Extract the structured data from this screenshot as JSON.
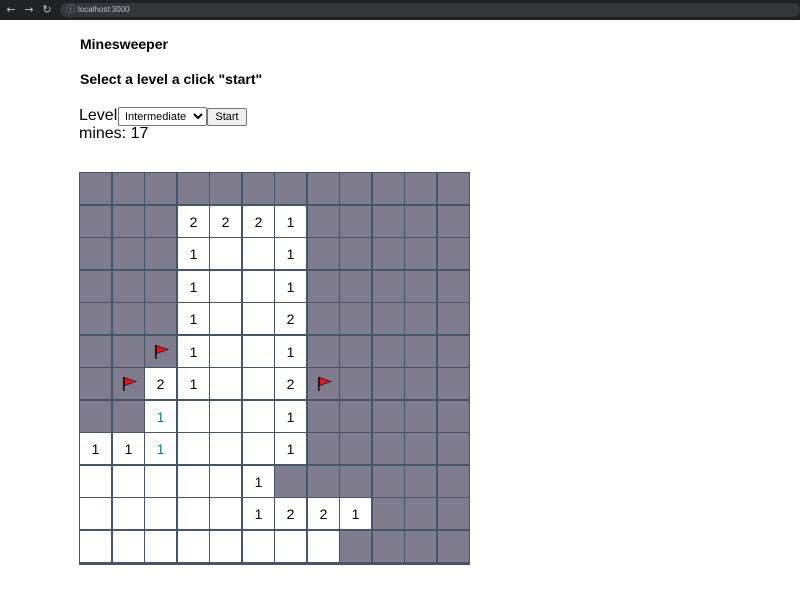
{
  "browser": {
    "url": "localhost:3000",
    "icons": [
      "back-arrow-icon",
      "forward-arrow-icon",
      "reload-icon",
      "info-icon"
    ]
  },
  "page": {
    "title": "Minesweeper",
    "subtitle": "Select a level a click \"start\"",
    "level_label": "Level:",
    "level_selected": "Intermediate",
    "start_label": "Start",
    "mines_text": "mines: 17"
  },
  "colors": {
    "hidden_cell": "#7f7c8e",
    "open_cell": "#ffffff",
    "grid_line": "#475569",
    "flag": "#d11a2a",
    "number_teal": "#0e7c7b"
  },
  "board": {
    "rows": 12,
    "cols": 12,
    "legend": "H = hidden, . = empty open, F = flag, digit = count, t-suffix = teal-colored digit",
    "cells": [
      [
        "H",
        "H",
        "H",
        "H",
        "H",
        "H",
        "H",
        "H",
        "H",
        "H",
        "H",
        "H"
      ],
      [
        "H",
        "H",
        "H",
        "2",
        "2",
        "2",
        "1",
        "H",
        "H",
        "H",
        "H",
        "H"
      ],
      [
        "H",
        "H",
        "H",
        "1",
        ".",
        ".",
        "1",
        "H",
        "H",
        "H",
        "H",
        "H"
      ],
      [
        "H",
        "H",
        "H",
        "1",
        ".",
        ".",
        "1",
        "H",
        "H",
        "H",
        "H",
        "H"
      ],
      [
        "H",
        "H",
        "H",
        "1",
        ".",
        ".",
        "2",
        "H",
        "H",
        "H",
        "H",
        "H"
      ],
      [
        "H",
        "H",
        "F",
        "1",
        ".",
        ".",
        "1",
        "H",
        "H",
        "H",
        "H",
        "H"
      ],
      [
        "H",
        "F",
        "2",
        "1",
        ".",
        ".",
        "2",
        "F",
        "H",
        "H",
        "H",
        "H"
      ],
      [
        "H",
        "H",
        "1t",
        ".",
        ".",
        ".",
        "1",
        "H",
        "H",
        "H",
        "H",
        "H"
      ],
      [
        "1",
        "1",
        "1t",
        ".",
        ".",
        ".",
        "1",
        "H",
        "H",
        "H",
        "H",
        "H"
      ],
      [
        ".",
        ".",
        ".",
        ".",
        ".",
        "1",
        "H",
        "H",
        "H",
        "H",
        "H",
        "H"
      ],
      [
        ".",
        ".",
        ".",
        ".",
        ".",
        "1",
        "2",
        "2",
        "1",
        "H",
        "H",
        "H"
      ],
      [
        ".",
        ".",
        ".",
        ".",
        ".",
        ".",
        ".",
        ".",
        "H",
        "H",
        "H",
        "H"
      ]
    ]
  }
}
